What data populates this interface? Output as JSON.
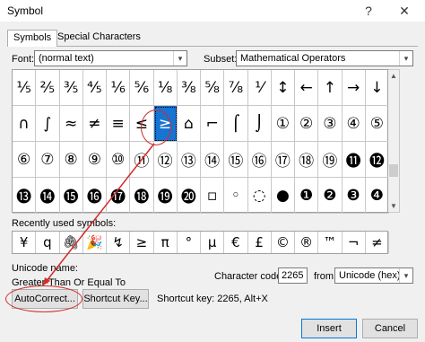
{
  "title": "Symbol",
  "titlebar": {
    "help": "?",
    "close": "✕"
  },
  "tabs": [
    "Symbols",
    "Special Characters"
  ],
  "font": {
    "label": "Font:",
    "value": "(normal text)"
  },
  "subset": {
    "label": "Subset:",
    "value": "Mathematical Operators"
  },
  "symbols": [
    [
      "⅓",
      "⅔",
      "⅗",
      "⅘",
      "⅙",
      "⅚",
      "⅛",
      "⅜",
      "⅝",
      "⅞",
      "⅟",
      "←",
      "↑",
      "→",
      "↓",
      "↔"
    ],
    [
      "↕",
      "↨",
      "∂",
      "∆",
      "∏",
      "∑",
      "−",
      "∕",
      "∙",
      "√",
      "∞",
      "∟",
      "∩",
      "∫",
      "≈",
      "≠"
    ],
    [
      "≡",
      "≤",
      "≥",
      "⌂",
      "⌐",
      "⌠",
      "⌡",
      "─",
      "│",
      "┌",
      "┐",
      "└",
      "┘",
      "├",
      "┤",
      "┬"
    ],
    [
      "┴",
      "┼",
      "═",
      "║",
      "╒",
      "╓",
      "╔",
      "╕",
      "╖",
      "╗",
      "╘",
      "╙",
      "╚",
      "╛",
      "╜",
      "╝"
    ]
  ],
  "visible_symbols": [
    [
      "⅕",
      "⅖",
      "⅗",
      "⅘",
      "⅙",
      "⅚",
      "⅛",
      "⅜",
      "⅝",
      "⅞",
      "⅟",
      "↕",
      "←",
      "↑",
      "→",
      "↓"
    ],
    [
      "∩",
      "∫",
      "≈",
      "≠",
      "≡",
      "≤",
      "≥",
      "⌂",
      "⌐",
      "⌠",
      "⌡",
      "①",
      "②",
      "③",
      "④",
      "⑤",
      "⑥"
    ],
    [
      "⑦",
      "⑧",
      "⑨",
      "⑩",
      "⑪",
      "⑫",
      "⑬",
      "⑭",
      "⑮",
      "⑯",
      "⑰",
      "⑱",
      "⑲",
      "⑳",
      "⓫",
      "⓬"
    ],
    [
      "⓭",
      "⓮",
      "⓯",
      "⓰",
      "⓱",
      "⓲",
      "⓳",
      "⓴",
      "┌",
      "╌",
      "╷",
      "╵",
      "└",
      "┐",
      "▫",
      "□"
    ]
  ],
  "grid_rows": [
    [
      "⅕",
      "⅖",
      "⅗",
      "⅘",
      "⅙",
      "⅚",
      "⅛",
      "⅜",
      "⅝",
      "⅞",
      "⅟",
      "↕",
      "←",
      "↑",
      "→",
      "↓"
    ],
    [
      "∩",
      "∫",
      "≈",
      "≠",
      "≡",
      "≤",
      "≥",
      "⌂",
      "⌐",
      "⌠",
      "⌡",
      "①",
      "②",
      "③",
      "④",
      "⑤"
    ],
    [
      "⑦",
      "⑧",
      "⑨",
      "⑩",
      "⑪",
      "⑫",
      "⑬",
      "⑭",
      "⑮",
      "⑯",
      "⑰",
      "⑱",
      "⑲",
      "⑳",
      "⓫",
      "⓬"
    ],
    [
      "⓭",
      "⓮",
      "⓯",
      "⓰",
      "⓱",
      "⓲",
      "⓳",
      "⓴",
      "▫",
      "▫",
      "▫",
      "┐",
      "└",
      "▫",
      "⌐",
      "□"
    ]
  ],
  "grid": [
    [
      "⅕",
      "⅖",
      "⅗",
      "⅘",
      "⅙",
      "⅚",
      "⅛",
      "⅜",
      "⅝",
      "⅞",
      "⅟",
      "↕",
      "←",
      "↑",
      "→",
      "↓"
    ],
    [
      "∩",
      "∫",
      "≈",
      "≠",
      "≡",
      "≤",
      "≥",
      "⌂",
      "⌐",
      "⌠",
      "⌡",
      "①",
      "②",
      "③",
      "④",
      "⑤"
    ],
    [
      "⑥",
      "⑦",
      "⑧",
      "⑨",
      "⑩",
      "⑪",
      "⑫",
      "⑬",
      "⑭",
      "⑮",
      "⑯",
      "⑰",
      "⑱",
      "⑲",
      "⓫",
      "⓬"
    ],
    [
      "⓭",
      "⓮",
      "⓯",
      "⓰",
      "⓱",
      "⓲",
      "⓳",
      "⓴",
      "▫",
      "◦",
      "◌",
      "●",
      "❶",
      "❷",
      "❸",
      "❹"
    ]
  ],
  "selected_symbol": "≥",
  "recent": {
    "label": "Recently used symbols:",
    "items": [
      "¥",
      "q",
      "🖇",
      "🎉",
      "↯",
      "≥",
      "π",
      "°",
      "µ",
      "€",
      "£",
      "©",
      "®",
      "™",
      "¬",
      "≠"
    ]
  },
  "unicode_name": {
    "label": "Unicode name:",
    "value": "Greater-Than Or Equal To"
  },
  "character_code": {
    "label": "Character code:",
    "value": "2265"
  },
  "from": {
    "label": "from:",
    "value": "Unicode (hex)"
  },
  "autocorrect_label": "AutoCorrect...",
  "shortcut_key_label": "Shortcut Key...",
  "shortcut_text": "Shortcut key: 2265, Alt+X",
  "insert_label": "Insert",
  "cancel_label": "Cancel",
  "colors": {
    "selection": "#1874d2",
    "annotation": "#d42a2a"
  }
}
